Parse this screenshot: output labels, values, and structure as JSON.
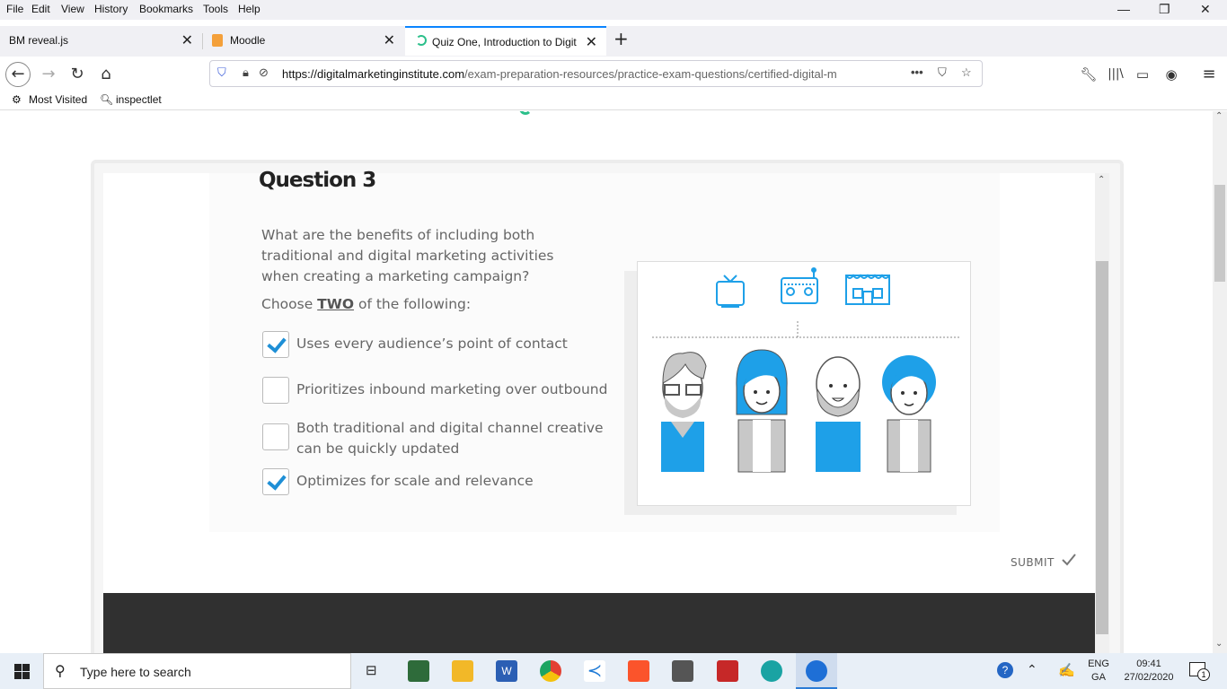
{
  "menu": [
    "File",
    "Edit",
    "View",
    "History",
    "Bookmarks",
    "Tools",
    "Help"
  ],
  "tabs": [
    {
      "title": "BM reveal.js"
    },
    {
      "title": "Moodle"
    },
    {
      "title": "Quiz One, Introduction to Digit"
    }
  ],
  "url": {
    "host": "https://digitalmarketinginstitute.com",
    "path": "/exam-preparation-resources/practice-exam-questions/certified-digital-m"
  },
  "bookmarks": [
    "Most Visited",
    "inspectlet"
  ],
  "quiz": {
    "title": "Question 3",
    "question": "What are the benefits of including both traditional and digital marketing activities when creating a marketing campaign?",
    "choose_prefix": "Choose",
    "choose_em": "TWO",
    "choose_suffix": "of the following:",
    "options": [
      {
        "label": "Uses every audience’s point of contact",
        "checked": true
      },
      {
        "label": "Prioritizes inbound marketing over outbound",
        "checked": false
      },
      {
        "label_line1": "Both traditional and digital channel creative",
        "label_line2": "can be quickly updated",
        "checked": false
      },
      {
        "label": "Optimizes for scale and relevance",
        "checked": true
      }
    ],
    "submit": "SUBMIT"
  },
  "taskbar": {
    "search_placeholder": "Type here to search",
    "lang1": "ENG",
    "lang2": "GA",
    "time": "09:41",
    "date": "27/02/2020",
    "notifications": "1"
  },
  "colors": {
    "accent": "#1ea0e8",
    "check": "#1e8fd6",
    "dark_footer": "#303030"
  }
}
